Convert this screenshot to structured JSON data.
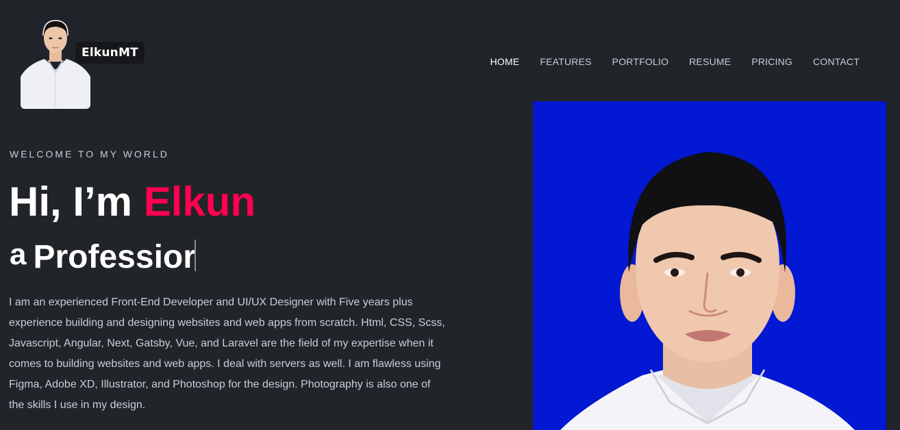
{
  "logo": {
    "name": "ElkunMT"
  },
  "nav": {
    "items": [
      {
        "label": "HOME",
        "active": true
      },
      {
        "label": "FEATURES",
        "active": false
      },
      {
        "label": "PORTFOLIO",
        "active": false
      },
      {
        "label": "RESUME",
        "active": false
      },
      {
        "label": "PRICING",
        "active": false
      },
      {
        "label": "CONTACT",
        "active": false
      }
    ]
  },
  "hero": {
    "eyebrow": "WELCOME TO MY WORLD",
    "title_prefix": "Hi, I’m ",
    "title_name": "Elkun",
    "sub_lead": "a",
    "sub_typed": "Professior",
    "bio": "I am an experienced Front-End Developer and UI/UX Designer with Five years plus experience building and designing websites and web apps from scratch. Html, CSS, Scss, Javascript, Angular, Next, Gatsby, Vue, and Laravel are the field of my expertise when it comes to building websites and web apps. I deal with servers as well. I am flawless using Figma, Adobe XD, Illustrator, and Photoshop for the design. Photography is also one of the skills I use in my design."
  },
  "colors": {
    "background": "#212428",
    "accent": "#ff014f",
    "text_muted": "#c4cfde",
    "portrait_background": "#0218d2"
  }
}
